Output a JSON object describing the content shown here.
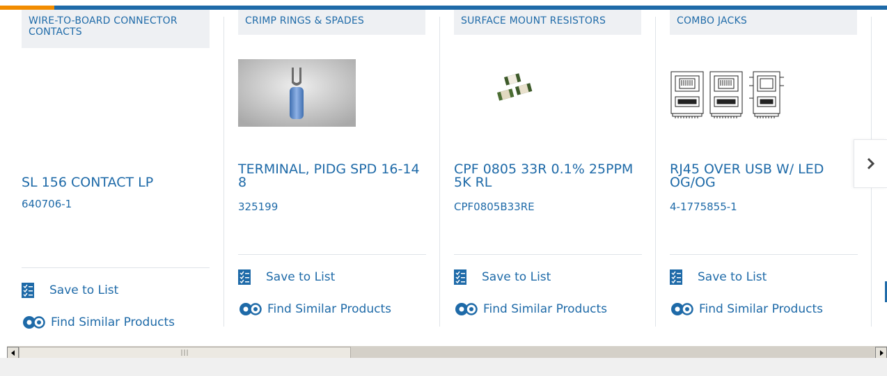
{
  "cards": [
    {
      "category": "WIRE-TO-BOARD CONNECTOR CONTACTS",
      "title": "SL 156 CONTACT LP",
      "part_number": "640706-1",
      "image": "none",
      "save_label": "Save to List",
      "similar_label": "Find Similar Products"
    },
    {
      "category": "CRIMP RINGS & SPADES",
      "title": "TERMINAL, PIDG SPD 16-14 8",
      "part_number": "325199",
      "image": "spade-terminal-photo",
      "save_label": "Save to List",
      "similar_label": "Find Similar Products"
    },
    {
      "category": "SURFACE MOUNT RESISTORS",
      "title": "CPF 0805 33R 0.1% 25PPM 5K RL",
      "part_number": "CPF0805B33RE",
      "image": "smd-resistor-photo",
      "save_label": "Save to List",
      "similar_label": "Find Similar Products"
    },
    {
      "category": "COMBO JACKS",
      "title": "RJ45 OVER USB W/ LED OG/OG",
      "part_number": "4-1775855-1",
      "image": "rj45-usb-jack-drawing",
      "save_label": "Save to List",
      "similar_label": "Find Similar Products"
    }
  ],
  "icons": {
    "save": "checklist-icon",
    "similar": "gears-icon",
    "next": "chevron-right-icon"
  },
  "colors": {
    "link": "#1e6aa8",
    "accent_bar": "#1e6aa8",
    "accent_orange": "#f28c00",
    "category_bg": "#eef0f3"
  }
}
